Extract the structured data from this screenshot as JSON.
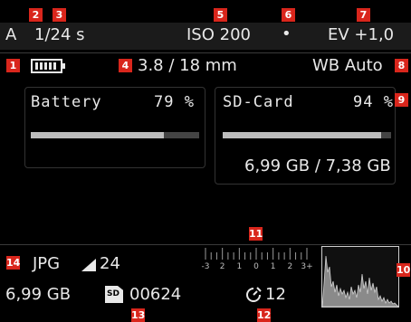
{
  "status": {
    "mode": "A",
    "shutter": "1/24 s",
    "iso": "ISO 200",
    "dot": "•",
    "ev": "EV +1,0",
    "focal": "3.8 / 18 mm",
    "wb": "WB Auto"
  },
  "battery": {
    "label": "Battery",
    "percent_label": "79 %",
    "level": 0.79
  },
  "sdcard": {
    "label": "SD-Card",
    "percent_label": "94 %",
    "level": 0.94,
    "capacity": "6,99 GB / 7,38 GB"
  },
  "bottom": {
    "format": "JPG",
    "quality_count": "24",
    "free_space": "6,99 GB",
    "sd_icon_label": "SD",
    "shots": "00624",
    "self_timer": "12",
    "exposure_scale": [
      "-3",
      "2",
      "1",
      "0",
      "1",
      "2",
      "3+"
    ]
  },
  "callouts": [
    "1",
    "2",
    "3",
    "4",
    "5",
    "6",
    "7",
    "8",
    "9",
    "10",
    "11",
    "12",
    "13",
    "14"
  ],
  "colors": {
    "callout": "#d9261c",
    "background": "#000000",
    "text": "#e8e8e8"
  }
}
